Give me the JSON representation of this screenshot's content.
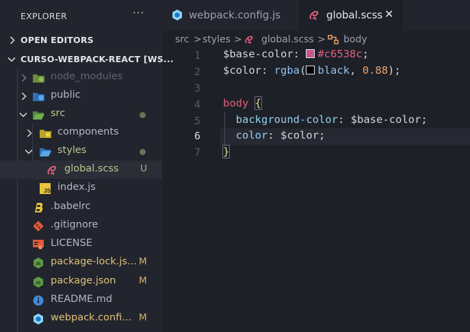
{
  "explorer": {
    "title": "EXPLORER",
    "more": "···",
    "open_editors": "OPEN EDITORS",
    "workspace": "CURSO-WEBPACK-REACT [WS...",
    "items": [
      {
        "label": "node_modules",
        "badge": ""
      },
      {
        "label": "public",
        "badge": ""
      },
      {
        "label": "src",
        "badge": ""
      },
      {
        "label": "components",
        "badge": ""
      },
      {
        "label": "styles",
        "badge": ""
      },
      {
        "label": "global.scss",
        "badge": "U"
      },
      {
        "label": "index.js",
        "badge": ""
      },
      {
        "label": ".babelrc",
        "badge": ""
      },
      {
        "label": ".gitignore",
        "badge": ""
      },
      {
        "label": "LICENSE",
        "badge": ""
      },
      {
        "label": "package-lock.js...",
        "badge": "M"
      },
      {
        "label": "package.json",
        "badge": "M"
      },
      {
        "label": "README.md",
        "badge": ""
      },
      {
        "label": "webpack.confi...",
        "badge": "M"
      }
    ]
  },
  "tabs": [
    {
      "label": "webpack.config.js",
      "active": false
    },
    {
      "label": "global.scss",
      "active": true,
      "close": "✕"
    }
  ],
  "breadcrumb": {
    "items": [
      "src",
      "styles",
      "global.scss",
      "body"
    ],
    "separator": ">"
  },
  "editor": {
    "line_numbers": [
      "1",
      "2",
      "3",
      "4",
      "5",
      "6",
      "7"
    ],
    "current_line": "6",
    "lines": [
      {
        "var": "$base-color",
        "colon": ":",
        "value": "#c6538c",
        "semi": ";"
      },
      {
        "var": "$color",
        "colon": ":",
        "fn": "rgba",
        "open": "(",
        "arg1": "black",
        "comma": ",",
        "arg2": "0.88",
        "close": ");"
      },
      {},
      {
        "selector": "body",
        "brace": "{"
      },
      {
        "prop": "background-color",
        "colon": ":",
        "value": "$base-color",
        "semi": ";"
      },
      {
        "prop": "color",
        "colon": ":",
        "value": "$color",
        "semi": ";"
      },
      {
        "brace": "}"
      }
    ]
  },
  "colors": {
    "accent_pink": "#e0617a",
    "swatch_color": "#c6538c",
    "swatch_black": "#000000"
  }
}
